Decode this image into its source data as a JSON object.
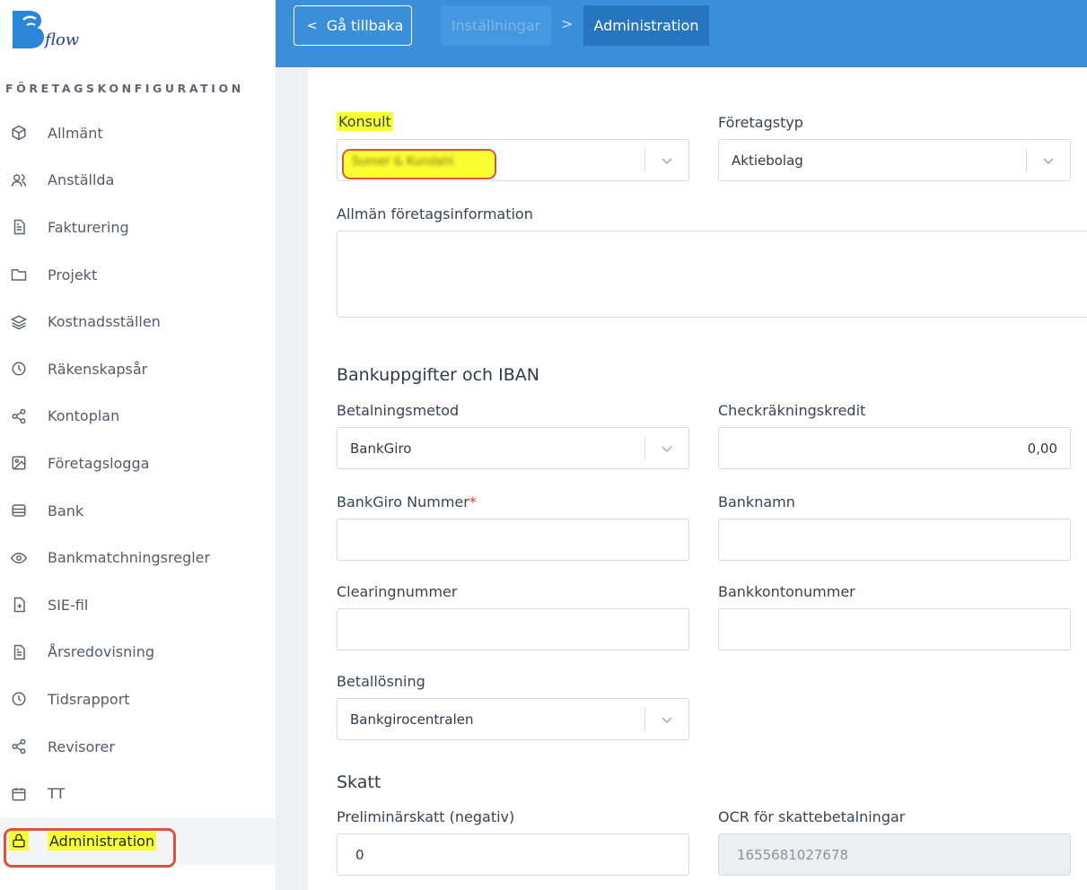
{
  "brand": {
    "logo_text": "flow"
  },
  "sidebar": {
    "section_title": "FÖRETAGSKONFIGURATION",
    "items": [
      {
        "label": "Allmänt",
        "icon": "cube-icon"
      },
      {
        "label": "Anställda",
        "icon": "users-icon"
      },
      {
        "label": "Fakturering",
        "icon": "document-icon"
      },
      {
        "label": "Projekt",
        "icon": "folder-icon"
      },
      {
        "label": "Kostnadsställen",
        "icon": "layers-icon"
      },
      {
        "label": "Räkenskapsår",
        "icon": "clock-icon"
      },
      {
        "label": "Kontoplan",
        "icon": "share-icon"
      },
      {
        "label": "Företagslogga",
        "icon": "image-icon"
      },
      {
        "label": "Bank",
        "icon": "database-icon"
      },
      {
        "label": "Bankmatchningsregler",
        "icon": "eye-icon"
      },
      {
        "label": "SIE-fil",
        "icon": "file-plus-icon"
      },
      {
        "label": "Årsredovisning",
        "icon": "document-icon"
      },
      {
        "label": "Tidsrapport",
        "icon": "clock-icon"
      },
      {
        "label": "Revisorer",
        "icon": "share-icon"
      },
      {
        "label": "TT",
        "icon": "calendar-icon"
      },
      {
        "label": "Administration",
        "icon": "lock-icon",
        "active": true
      }
    ]
  },
  "topbar": {
    "back_label": "Gå tillbaka",
    "crumb_settings": "Inställningar",
    "crumb_separator": ">",
    "crumb_current": "Administration"
  },
  "form": {
    "konsult_label": "Konsult",
    "konsult_value": "Sumer & Kundahl",
    "foretagstyp_label": "Företagstyp",
    "foretagstyp_value": "Aktiebolag",
    "info_label": "Allmän företagsinformation",
    "info_value": "",
    "bank_section": "Bankuppgifter och IBAN",
    "betalningsmetod_label": "Betalningsmetod",
    "betalningsmetod_value": "BankGiro",
    "checkkredit_label": "Checkräkningskredit",
    "checkkredit_value": "0,00",
    "bankgiro_label": "BankGiro Nummer",
    "bankgiro_required": "*",
    "bankgiro_value": "",
    "banknamn_label": "Banknamn",
    "banknamn_value": "",
    "clearing_label": "Clearingnummer",
    "clearing_value": "",
    "kontonummer_label": "Bankkontonummer",
    "kontonummer_value": "",
    "betallosning_label": "Betallösning",
    "betallosning_value": "Bankgirocentralen",
    "skatt_section": "Skatt",
    "prelskatt_label": "Preliminärskatt (negativ)",
    "prelskatt_value": "0",
    "ocr_label": "OCR för skattebetalningar",
    "ocr_value": "1655681027678"
  },
  "colors": {
    "topbar": "#3a8fd8",
    "highlight": "#f8ff33",
    "annotation_ring": "#d9533e"
  }
}
